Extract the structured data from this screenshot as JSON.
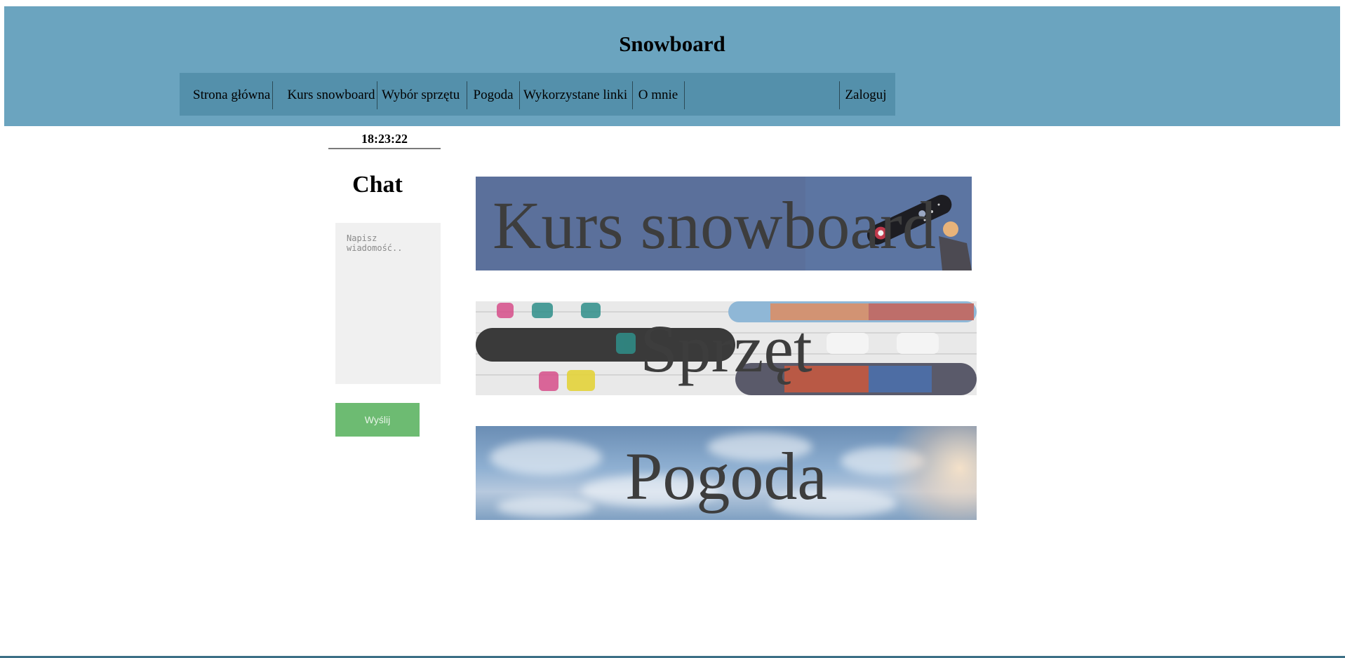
{
  "header": {
    "title": "Snowboard",
    "background_color": "#6ba4bf",
    "nav_color": "#5490ab"
  },
  "nav": {
    "items": [
      {
        "label": "Strona główna"
      },
      {
        "label": "Kurs snowboard"
      },
      {
        "label": "Wybór sprzętu"
      },
      {
        "label": "Pogoda"
      },
      {
        "label": "Wykorzystane linki"
      },
      {
        "label": "O mnie"
      }
    ],
    "login_label": "Zaloguj"
  },
  "sidebar": {
    "clock": "18:23:22",
    "chat_title": "Chat",
    "chat_placeholder": "Napisz wiadomość..",
    "send_label": "Wyślij",
    "send_color": "#6dbb72"
  },
  "banners": [
    {
      "label": "Kurs snowboard",
      "icon": "snowboarder-photo"
    },
    {
      "label": "Sprzęt",
      "icon": "snowboards-rack-photo"
    },
    {
      "label": "Pogoda",
      "icon": "sky-clouds-photo"
    }
  ]
}
